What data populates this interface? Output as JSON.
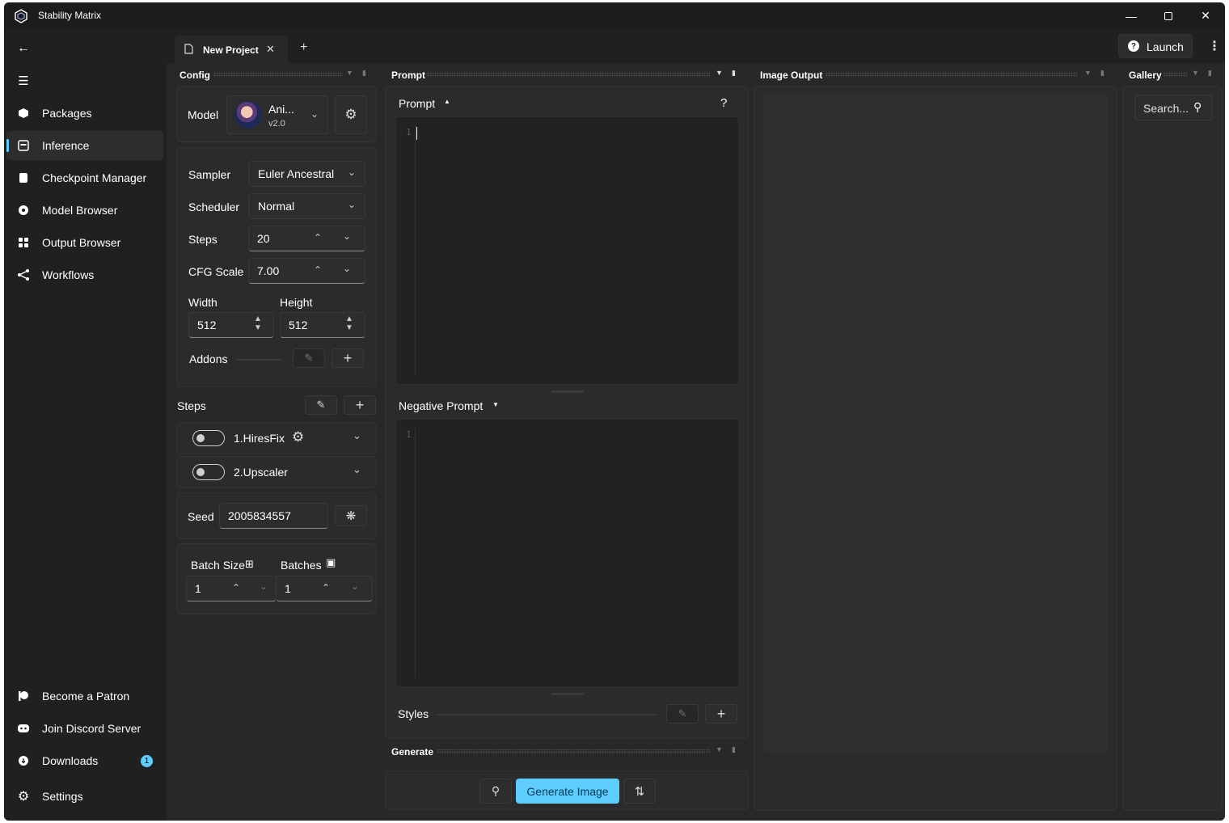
{
  "app": {
    "title": "Stability Matrix"
  },
  "sidebar": {
    "items": [
      {
        "label": "Packages",
        "icon": "package-icon"
      },
      {
        "label": "Inference",
        "icon": "inference-icon"
      },
      {
        "label": "Checkpoint Manager",
        "icon": "checkpoint-icon"
      },
      {
        "label": "Model Browser",
        "icon": "model-browser-icon"
      },
      {
        "label": "Output Browser",
        "icon": "grid-icon"
      },
      {
        "label": "Workflows",
        "icon": "workflow-icon"
      }
    ],
    "footer": [
      {
        "label": "Become a Patron",
        "icon": "patreon-icon"
      },
      {
        "label": "Join Discord Server",
        "icon": "discord-icon"
      },
      {
        "label": "Downloads",
        "icon": "download-icon",
        "badge": "1"
      },
      {
        "label": "Settings",
        "icon": "gear-icon"
      }
    ]
  },
  "tabs": {
    "active_label": "New Project"
  },
  "header": {
    "launch_label": "Launch"
  },
  "panes": {
    "config": "Config",
    "prompt": "Prompt",
    "image_output": "Image Output",
    "gallery": "Gallery",
    "generate": "Generate"
  },
  "config": {
    "model_label": "Model",
    "model_name": "Ani...",
    "model_version": "v2.0",
    "sampler_label": "Sampler",
    "sampler_value": "Euler Ancestral",
    "scheduler_label": "Scheduler",
    "scheduler_value": "Normal",
    "steps_label": "Steps",
    "steps_value": "20",
    "cfg_label": "CFG Scale",
    "cfg_value": "7.00",
    "width_label": "Width",
    "width_value": "512",
    "height_label": "Height",
    "height_value": "512",
    "addons_label": "Addons",
    "steps_section_label": "Steps",
    "step_items": [
      {
        "label": "1.HiresFix"
      },
      {
        "label": "2.Upscaler"
      }
    ],
    "seed_label": "Seed",
    "seed_value": "2005834557",
    "batch_size_label": "Batch Size",
    "batch_size_value": "1",
    "batches_label": "Batches",
    "batches_value": "1"
  },
  "prompt": {
    "prompt_label": "Prompt",
    "help": "?",
    "negative_label": "Negative Prompt",
    "line_number": "1",
    "styles_label": "Styles"
  },
  "generate": {
    "button_label": "Generate Image"
  },
  "gallery": {
    "search_placeholder": "Search..."
  },
  "colors": {
    "accent": "#60cdff",
    "background": "#202020",
    "panel": "#2b2b2b"
  }
}
